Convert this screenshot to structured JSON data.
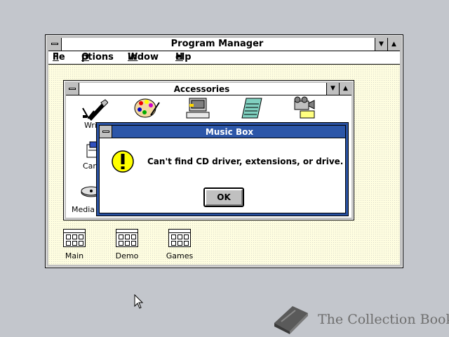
{
  "program_manager": {
    "title": "Program Manager",
    "menu": {
      "file": {
        "hot": "F",
        "rest": "ile"
      },
      "options": {
        "hot": "O",
        "rest": "ptions"
      },
      "window": {
        "hot": "W",
        "rest": "indow"
      },
      "help": {
        "hot": "H",
        "rest": "elp"
      }
    },
    "groups": [
      {
        "label": "Main"
      },
      {
        "label": "Demo"
      },
      {
        "label": "Games"
      }
    ]
  },
  "accessories": {
    "title": "Accessories",
    "items": [
      {
        "label": "Wri",
        "icon": "write-pen-icon"
      },
      {
        "label": "",
        "icon": "paintbrush-palette-icon"
      },
      {
        "label": "",
        "icon": "terminal-icon"
      },
      {
        "label": "",
        "icon": "notepad-icon"
      },
      {
        "label": "",
        "icon": "recorder-camera-icon"
      },
      {
        "label": "Card",
        "icon": "cardfile-icon"
      },
      {
        "label": "Media",
        "icon": "media-player-icon"
      }
    ]
  },
  "dialog": {
    "title": "Music Box",
    "message": "Can't find CD driver, extensions, or drive.",
    "ok_label": "OK",
    "icon": "exclamation-warning-icon"
  },
  "watermark": {
    "text": "The Collection Book"
  },
  "colors": {
    "desktop": "#c3c6cc",
    "active_title": "#2c56a8",
    "workspace": "#fefde0"
  }
}
